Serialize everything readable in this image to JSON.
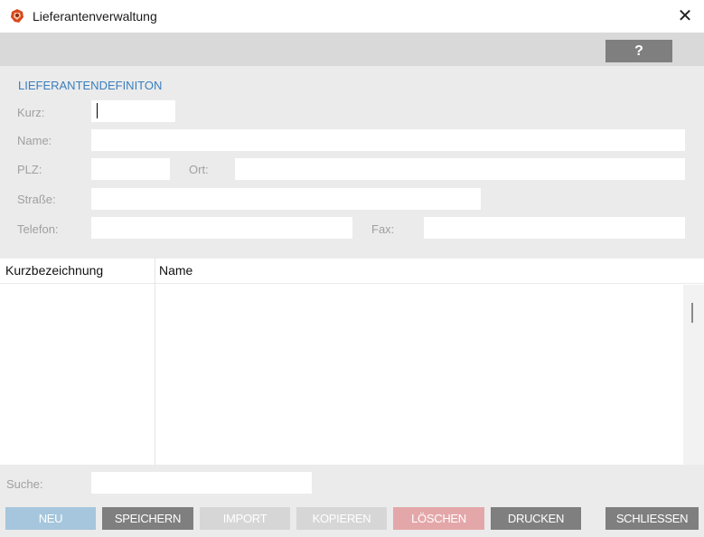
{
  "window": {
    "title": "Lieferantenverwaltung",
    "close_glyph": "✕",
    "app_icon": "supplier-app-icon"
  },
  "toolbar": {
    "help_label": "?"
  },
  "form": {
    "section_title": "LIEFERANTENDEFINITON",
    "kurz_label": "Kurz:",
    "kurz_value": "",
    "name_label": "Name:",
    "name_value": "",
    "plz_label": "PLZ:",
    "plz_value": "",
    "ort_label": "Ort:",
    "ort_value": "",
    "strasse_label": "Straße:",
    "strasse_value": "",
    "telefon_label": "Telefon:",
    "telefon_value": "",
    "fax_label": "Fax:",
    "fax_value": ""
  },
  "grid": {
    "columns": [
      "Kurzbezeichnung",
      "Name"
    ],
    "rows": []
  },
  "search": {
    "label": "Suche:",
    "value": ""
  },
  "buttons": {
    "new": "NEU",
    "save": "SPEICHERN",
    "import": "IMPORT",
    "copy": "KOPIEREN",
    "delete": "LÖSCHEN",
    "print": "DRUCKEN",
    "close": "SCHLIESSEN"
  },
  "colors": {
    "accent": "#3a7fbf",
    "button_new": "#a5c6dc",
    "button_dark": "#7f7f7f",
    "button_disabled": "#d6d6d6",
    "button_delete": "#e4a7a9",
    "panel_bg": "#ebebeb",
    "toolbar_bg": "#d9d9d9"
  }
}
